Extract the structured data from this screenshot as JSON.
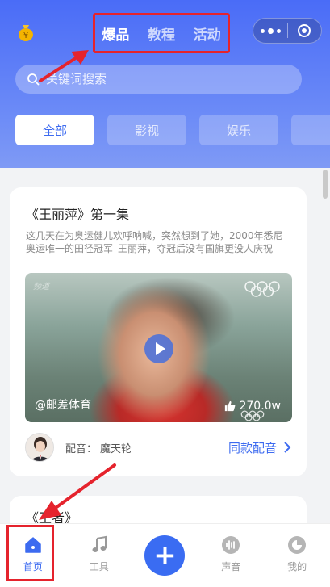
{
  "header": {
    "tabs": [
      {
        "label": "爆品",
        "active": true
      },
      {
        "label": "教程",
        "active": false
      },
      {
        "label": "活动",
        "active": false
      }
    ],
    "search_placeholder": "关键词搜索"
  },
  "categories": [
    {
      "label": "全部",
      "active": true
    },
    {
      "label": "影视",
      "active": false
    },
    {
      "label": "娱乐",
      "active": false
    },
    {
      "label": "",
      "active": false
    }
  ],
  "card1": {
    "title": "《王丽萍》第一集",
    "description": "这几天在为奥运健儿欢呼呐喊，突然想到了她，2000年悉尼奥运唯一的田径冠军–王丽萍，夺冠后没有国旗更没人庆祝",
    "video": {
      "watermark": "频道",
      "author": "@邮差体育",
      "likes": "270.0w"
    },
    "voice_label": "配音：",
    "voice_name": "魔天轮",
    "same_voice_button": "同款配音"
  },
  "card2": {
    "title": "《王者》"
  },
  "bottom_nav": [
    {
      "label": "首页",
      "icon": "home-icon",
      "active": true
    },
    {
      "label": "工具",
      "icon": "music-note-icon",
      "active": false
    },
    {
      "label": "",
      "icon": "plus-icon",
      "active": false
    },
    {
      "label": "声音",
      "icon": "sound-wave-icon",
      "active": false
    },
    {
      "label": "我的",
      "icon": "profile-icon",
      "active": false
    }
  ],
  "colors": {
    "accent": "#3d6bf0",
    "annotation": "#e5232d",
    "header_gradient_top": "#4a6cf7"
  }
}
